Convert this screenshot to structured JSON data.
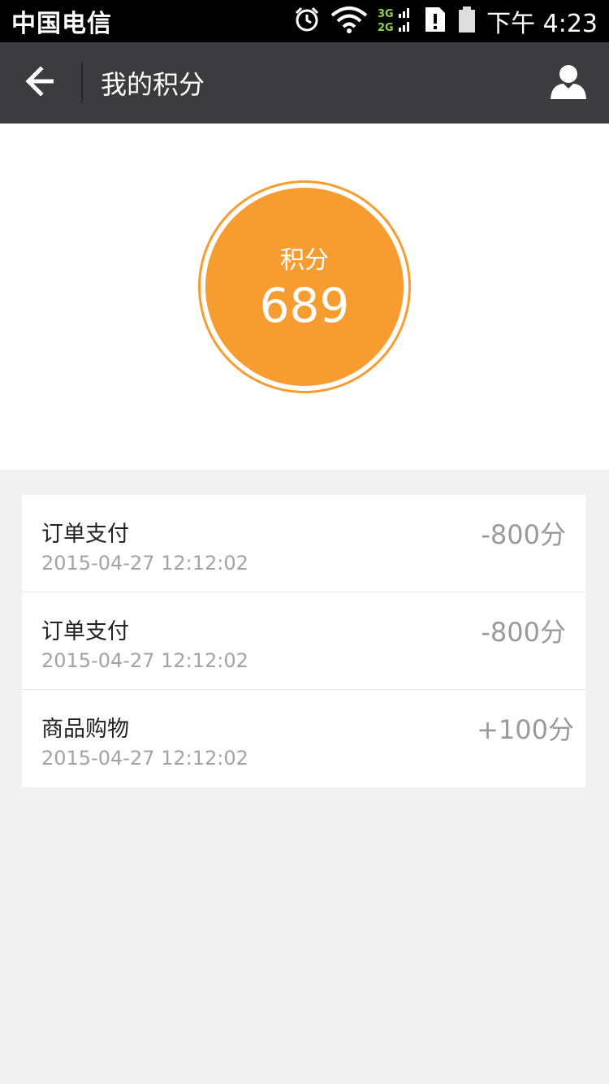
{
  "status_bar": {
    "carrier": "中国电信",
    "network_top": "3G",
    "network_bottom": "2G",
    "time": "下午 4:23",
    "icons": [
      "alarm-icon",
      "wifi-icon",
      "signal-icon",
      "sim-alert-icon",
      "battery-icon"
    ]
  },
  "nav": {
    "title": "我的积分",
    "back_icon": "arrow-left-icon",
    "user_icon": "user-icon"
  },
  "points": {
    "label": "积分",
    "value": "689",
    "accent_color": "#f79c30"
  },
  "records": [
    {
      "title": "订单支付",
      "time": "2015-04-27 12:12:02",
      "amount": "-800分"
    },
    {
      "title": "订单支付",
      "time": "2015-04-27 12:12:02",
      "amount": "-800分"
    },
    {
      "title": "商品购物",
      "time": "2015-04-27 12:12:02",
      "amount": "+100分"
    }
  ]
}
